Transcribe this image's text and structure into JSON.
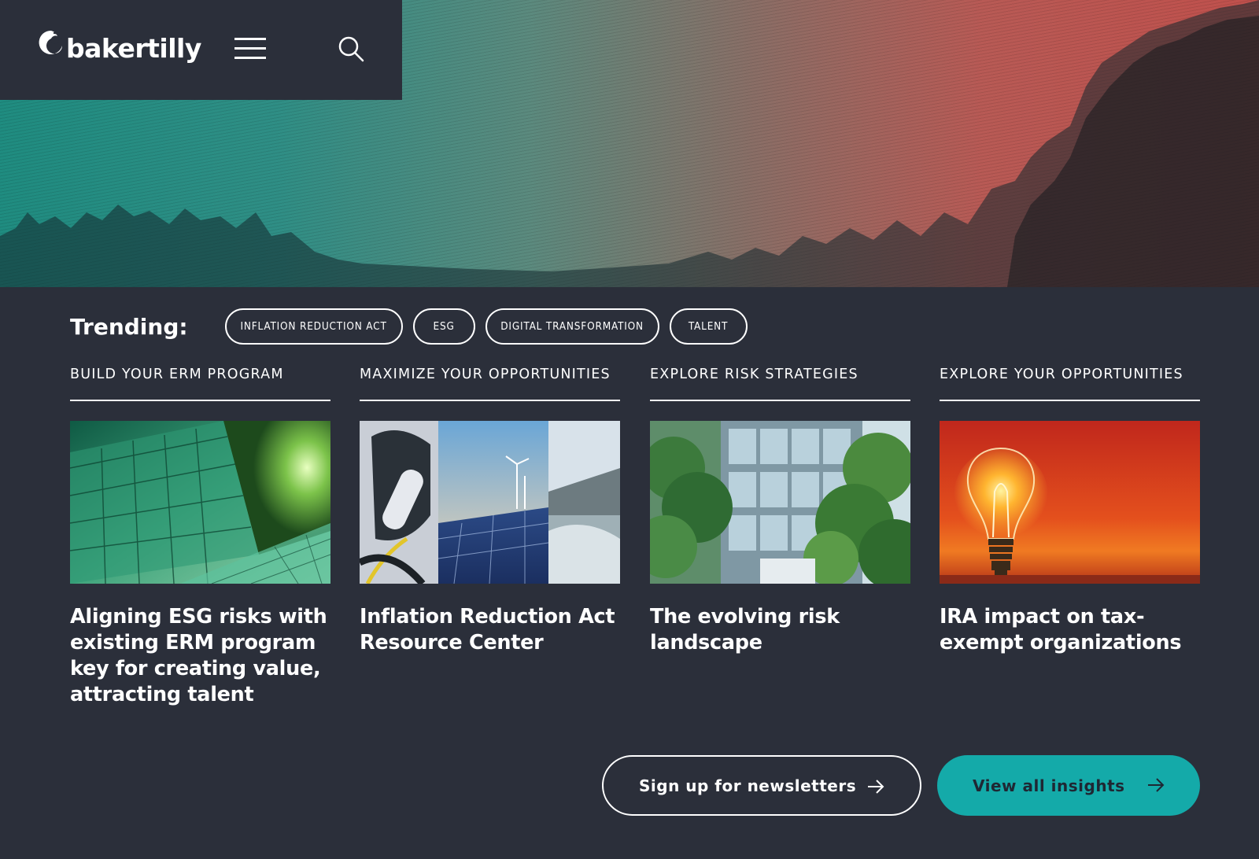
{
  "header": {
    "logo_text": "bakertilly",
    "menu_icon": "hamburger-icon",
    "search_icon": "search-icon"
  },
  "trending": {
    "label": "Trending:",
    "tags": [
      "INFLATION REDUCTION ACT",
      "ESG",
      "DIGITAL TRANSFORMATION",
      "TALENT"
    ]
  },
  "columns": [
    {
      "heading": "BUILD YOUR ERM PROGRAM",
      "title": "Aligning ESG risks with existing ERM program key for creating value, attracting talent",
      "image": "green-glass-building-trees"
    },
    {
      "heading": "MAXIMIZE YOUR OPPORTUNITIES",
      "title": "Inflation Reduction Act Resource Center",
      "image": "ev-charger-solar-wind-dam"
    },
    {
      "heading": "EXPLORE RISK STRATEGIES",
      "title": "The evolving risk landscape",
      "image": "glass-office-trees"
    },
    {
      "heading": "EXPLORE YOUR OPPORTUNITIES",
      "title": "IRA impact on tax-exempt organizations",
      "image": "lightbulb-sunset"
    }
  ],
  "buttons": {
    "newsletter": "Sign up for newsletters",
    "insights": "View all insights"
  },
  "colors": {
    "background": "#2b2f3a",
    "accent": "#14aaa9",
    "hero_left": "#1f8c80",
    "hero_right": "#c0504c"
  }
}
